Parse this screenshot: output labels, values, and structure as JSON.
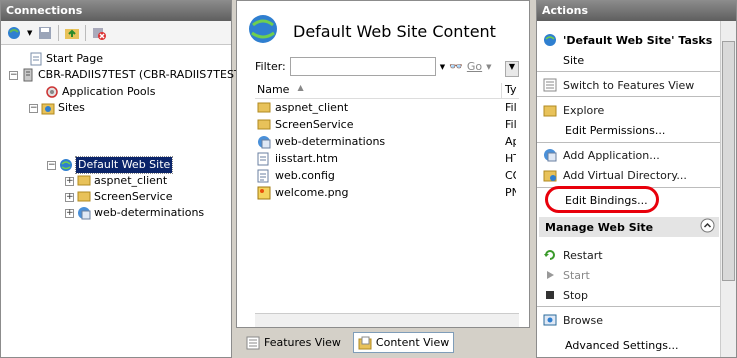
{
  "connections": {
    "title": "Connections",
    "tree": [
      {
        "label": "Start Page"
      },
      {
        "label": "CBR-RADIIS7TEST (CBR-RADIIS7TEST"
      },
      {
        "label": "Application Pools"
      },
      {
        "label": "Sites"
      },
      {
        "label": "Default Web Site"
      },
      {
        "label": "aspnet_client"
      },
      {
        "label": "ScreenService"
      },
      {
        "label": "web-determinations"
      }
    ]
  },
  "content": {
    "title": "Default Web Site Content",
    "filter_label": "Filter:",
    "go_label": "Go",
    "col_name": "Name",
    "col_type": "Ty",
    "files": [
      {
        "name": "aspnet_client",
        "type": "Fil"
      },
      {
        "name": "ScreenService",
        "type": "Fil"
      },
      {
        "name": "web-determinations",
        "type": "Ap"
      },
      {
        "name": "iisstart.htm",
        "type": "HT"
      },
      {
        "name": "web.config",
        "type": "CO"
      },
      {
        "name": "welcome.png",
        "type": "PN"
      }
    ],
    "tab_features": "Features View",
    "tab_content": "Content View"
  },
  "actions": {
    "title": "Actions",
    "tasks_title": "'Default Web Site' Tasks",
    "site": "Site",
    "switch": "Switch to Features View",
    "explore": "Explore",
    "edit_permissions": "Edit Permissions...",
    "add_application": "Add Application...",
    "add_vdir": "Add Virtual Directory...",
    "edit_bindings": "Edit Bindings...",
    "manage_title": "Manage Web Site",
    "restart": "Restart",
    "start": "Start",
    "stop": "Stop",
    "browse": "Browse",
    "advanced": "Advanced Settings..."
  },
  "colors": {
    "highlight": "#e8000b",
    "selection": "#0a246a"
  }
}
